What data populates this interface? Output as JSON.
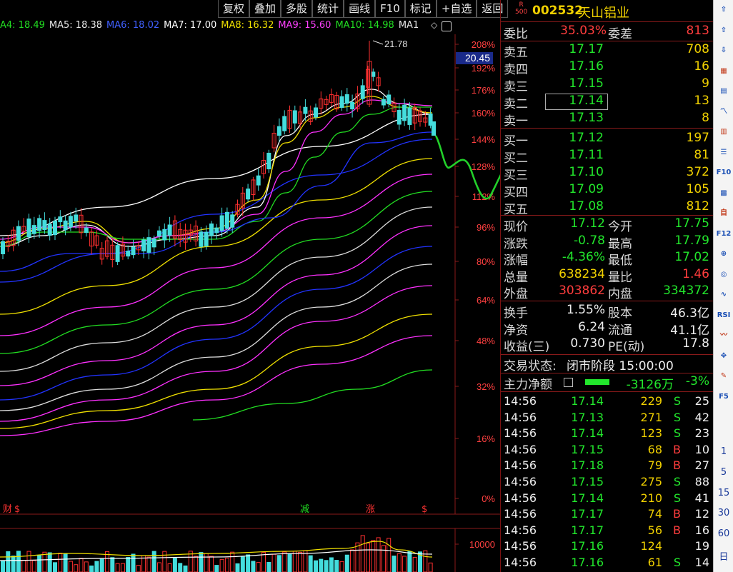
{
  "toolbar": {
    "items": [
      "复权",
      "叠加",
      "多股",
      "统计",
      "画线",
      "F10",
      "标记",
      "+自选",
      "返回"
    ]
  },
  "ma_row": [
    {
      "label": "A4: 18.49",
      "color": "#22dd22"
    },
    {
      "label": "MA5: 18.38",
      "color": "#e8e8e8"
    },
    {
      "label": "MA6: 18.02",
      "color": "#4060ff"
    },
    {
      "label": "MA7: 17.00",
      "color": "#ffffff"
    },
    {
      "label": "MA8: 16.32",
      "color": "#f0e000"
    },
    {
      "label": "MA9: 15.60",
      "color": "#ff40ff"
    },
    {
      "label": "MA10: 14.98",
      "color": "#22dd22"
    },
    {
      "label": "MA1",
      "color": "#e8e8e8"
    }
  ],
  "chart": {
    "price_axis": [
      "208%",
      "192%",
      "176%",
      "160%",
      "144%",
      "128%",
      "112%",
      "96%",
      "80%",
      "64%",
      "48%",
      "32%",
      "16%",
      "0%"
    ],
    "current_price_tag": "20.45",
    "peak_label": "21.78",
    "event_markers": [
      {
        "text": "财",
        "color": "#ff3333"
      },
      {
        "text": "$",
        "color": "#ff3333"
      },
      {
        "text": "减",
        "color": "#22dd22"
      },
      {
        "text": "涨",
        "color": "#ff3333"
      },
      {
        "text": "$",
        "color": "#ff3333"
      }
    ],
    "volume_axis": "10000"
  },
  "quote": {
    "code": "002532",
    "name": "天山铝业",
    "badge_top": "R",
    "badge_bottom": "500",
    "weibi_label": "委比",
    "weibi_value": "35.03%",
    "weicha_label": "委差",
    "weicha_value": "813",
    "sell": [
      {
        "label": "卖五",
        "price": "17.17",
        "vol": "708"
      },
      {
        "label": "卖四",
        "price": "17.16",
        "vol": "16"
      },
      {
        "label": "卖三",
        "price": "17.15",
        "vol": "9"
      },
      {
        "label": "卖二",
        "price": "17.14",
        "vol": "13"
      },
      {
        "label": "卖一",
        "price": "17.13",
        "vol": "8"
      }
    ],
    "buy": [
      {
        "label": "买一",
        "price": "17.12",
        "vol": "197"
      },
      {
        "label": "买二",
        "price": "17.11",
        "vol": "81"
      },
      {
        "label": "买三",
        "price": "17.10",
        "vol": "372"
      },
      {
        "label": "买四",
        "price": "17.09",
        "vol": "105"
      },
      {
        "label": "买五",
        "price": "17.08",
        "vol": "812"
      }
    ],
    "stats": [
      {
        "l1": "现价",
        "v1": "17.12",
        "c1": "green",
        "l2": "今开",
        "v2": "17.75",
        "c2": "green"
      },
      {
        "l1": "涨跌",
        "v1": "-0.78",
        "c1": "green",
        "l2": "最高",
        "v2": "17.79",
        "c2": "green"
      },
      {
        "l1": "涨幅",
        "v1": "-4.36%",
        "c1": "green",
        "l2": "最低",
        "v2": "17.02",
        "c2": "green"
      },
      {
        "l1": "总量",
        "v1": "638234",
        "c1": "yellow",
        "l2": "量比",
        "v2": "1.46",
        "c2": "red"
      },
      {
        "l1": "外盘",
        "v1": "303862",
        "c1": "red",
        "l2": "内盘",
        "v2": "334372",
        "c2": "green"
      }
    ],
    "fund": [
      {
        "l1": "换手",
        "v1": "1.55%",
        "l2": "股本",
        "v2": "46.3亿"
      },
      {
        "l1": "净资",
        "v1": "6.24",
        "l2": "流通",
        "v2": "41.1亿"
      },
      {
        "l1": "收益(三)",
        "v1": "0.730",
        "l2": "PE(动)",
        "v2": "17.8"
      }
    ],
    "status_label": "交易状态:",
    "status_value": "闭市阶段 15:00:00",
    "main_flow_label": "主力净额",
    "main_flow_value": "-3126万",
    "main_flow_pct": "-3%"
  },
  "trades": [
    {
      "time": "14:56",
      "price": "17.14",
      "vol": "229",
      "side": "S",
      "n": "25"
    },
    {
      "time": "14:56",
      "price": "17.13",
      "vol": "271",
      "side": "S",
      "n": "42"
    },
    {
      "time": "14:56",
      "price": "17.14",
      "vol": "123",
      "side": "S",
      "n": "23"
    },
    {
      "time": "14:56",
      "price": "17.15",
      "vol": "68",
      "side": "B",
      "n": "10"
    },
    {
      "time": "14:56",
      "price": "17.18",
      "vol": "79",
      "side": "B",
      "n": "27"
    },
    {
      "time": "14:56",
      "price": "17.15",
      "vol": "275",
      "side": "S",
      "n": "88"
    },
    {
      "time": "14:56",
      "price": "17.14",
      "vol": "210",
      "side": "S",
      "n": "41"
    },
    {
      "time": "14:56",
      "price": "17.17",
      "vol": "74",
      "side": "B",
      "n": "12"
    },
    {
      "time": "14:56",
      "price": "17.17",
      "vol": "56",
      "side": "B",
      "n": "16"
    },
    {
      "time": "14:56",
      "price": "17.16",
      "vol": "124",
      "side": "",
      "n": "19"
    },
    {
      "time": "14:56",
      "price": "17.16",
      "vol": "61",
      "side": "S",
      "n": "14"
    }
  ],
  "sidebar": {
    "icons": [
      "up-arrow-icon",
      "up-arrow-icon",
      "down-arrow-icon",
      "bars-icon",
      "boxes-icon",
      "line-chart-icon",
      "candle-icon",
      "list-icon",
      "f10-icon",
      "grid-icon",
      "self-icon",
      "f12-icon",
      "zoom-icon",
      "circle-icon",
      "wave-icon",
      "rsi-icon",
      "curve-icon",
      "move-icon",
      "pen-icon",
      "f5-icon"
    ],
    "rsi_label": "RSI",
    "f10_label": "F10",
    "f12_label": "F12",
    "f5_label": "F5",
    "nums": [
      "1",
      "5",
      "15",
      "30",
      "60",
      "日"
    ]
  }
}
